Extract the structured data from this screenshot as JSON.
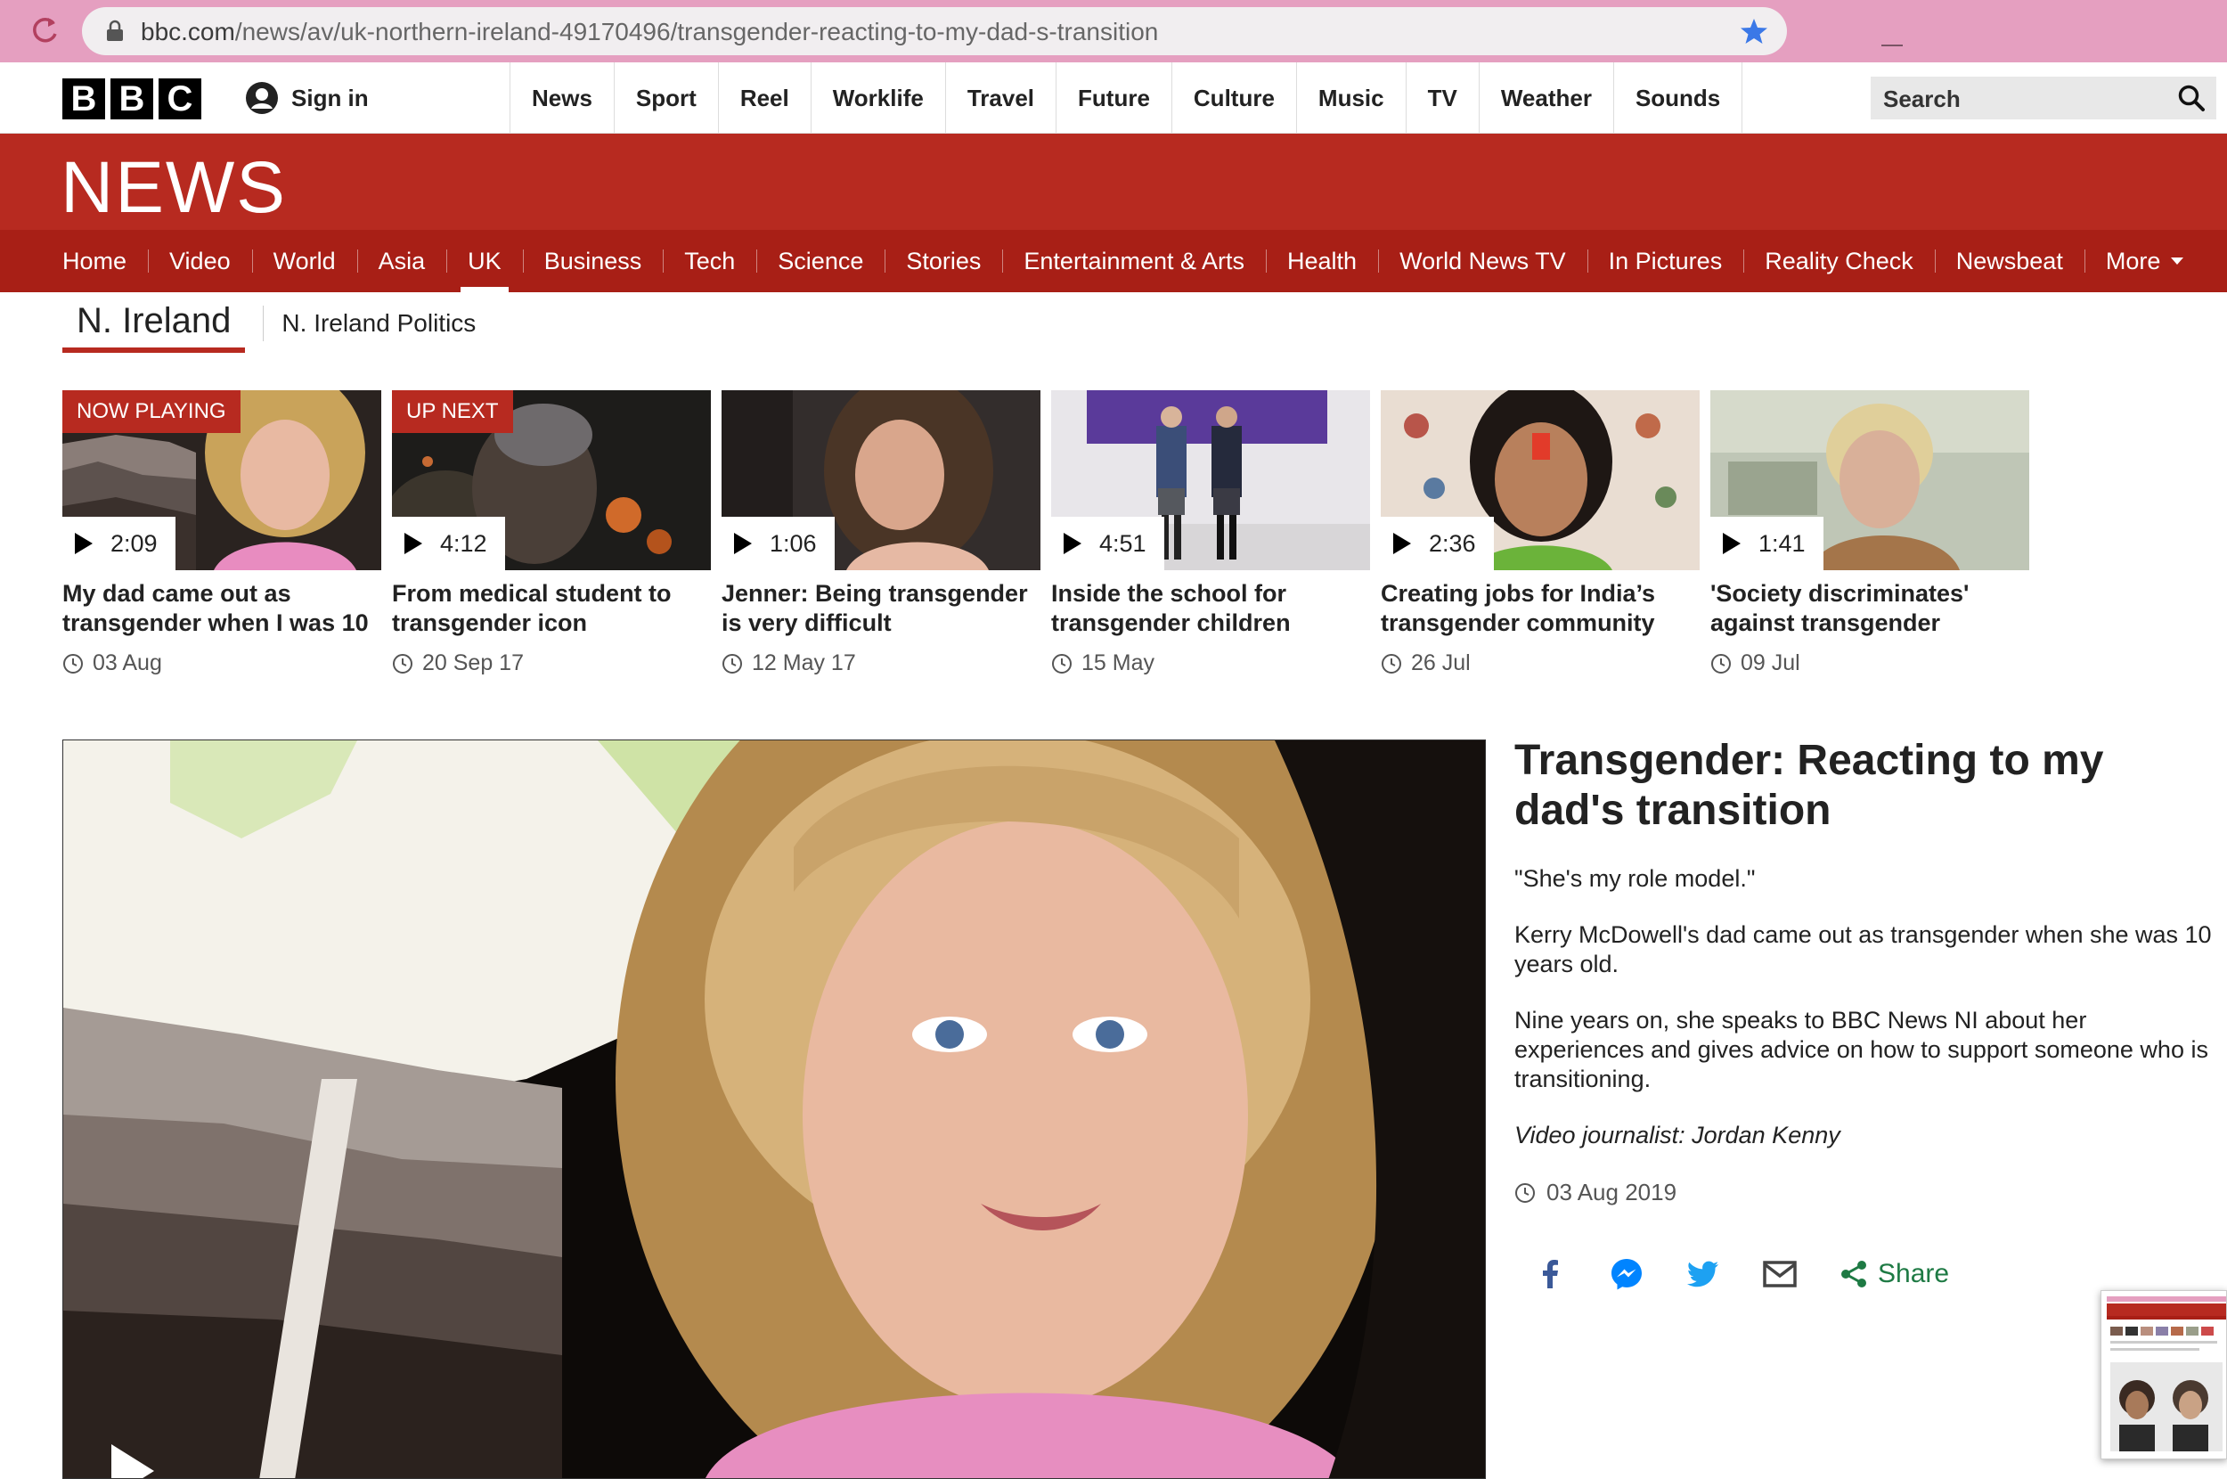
{
  "browser": {
    "url_host": "bbc.com",
    "url_path": "/news/av/uk-northern-ireland-49170496/transgender-reacting-to-my-dad-s-transition"
  },
  "bbc_header": {
    "logo_letters": [
      "B",
      "B",
      "C"
    ],
    "signin_label": "Sign in",
    "nav": [
      "News",
      "Sport",
      "Reel",
      "Worklife",
      "Travel",
      "Future",
      "Culture",
      "Music",
      "TV",
      "Weather",
      "Sounds"
    ],
    "search_placeholder": "Search"
  },
  "news": {
    "title": "NEWS",
    "sections": [
      "Home",
      "Video",
      "World",
      "Asia",
      "UK",
      "Business",
      "Tech",
      "Science",
      "Stories",
      "Entertainment & Arts",
      "Health",
      "World News TV",
      "In Pictures",
      "Reality Check",
      "Newsbeat",
      "More"
    ],
    "active_section": "UK"
  },
  "subnav": {
    "primary": "N. Ireland",
    "secondary": "N. Ireland Politics"
  },
  "carousel": [
    {
      "badge": "NOW PLAYING",
      "duration": "2:09",
      "title": "My dad came out as transgender when I was 10",
      "date": "03 Aug"
    },
    {
      "badge": "UP NEXT",
      "duration": "4:12",
      "title": "From medical student to transgender icon",
      "date": "20 Sep 17"
    },
    {
      "badge": "",
      "duration": "1:06",
      "title": "Jenner: Being transgender is very difficult",
      "date": "12 May 17"
    },
    {
      "badge": "",
      "duration": "4:51",
      "title": "Inside the school for transgender children",
      "date": "15 May"
    },
    {
      "badge": "",
      "duration": "2:36",
      "title": "Creating jobs for India’s transgender community",
      "date": "26 Jul"
    },
    {
      "badge": "",
      "duration": "1:41",
      "title": "'Society discriminates' against transgender",
      "date": "09 Jul"
    }
  ],
  "article": {
    "headline": "Transgender: Reacting to my dad's transition",
    "paragraphs": [
      "\"She's my role model.\"",
      "Kerry McDowell's dad came out as transgender when she was 10 years old.",
      "Nine years on, she speaks to BBC News NI about her experiences and gives advice on how to support someone who is transitioning."
    ],
    "credit": "Video journalist: Jordan Kenny",
    "date": "03 Aug 2019",
    "share_label": "Share"
  },
  "colors": {
    "bbc_red": "#b72a20",
    "section_red": "#a81f16",
    "share_green": "#1e7a44",
    "browser_chrome": "#e59fc0"
  }
}
